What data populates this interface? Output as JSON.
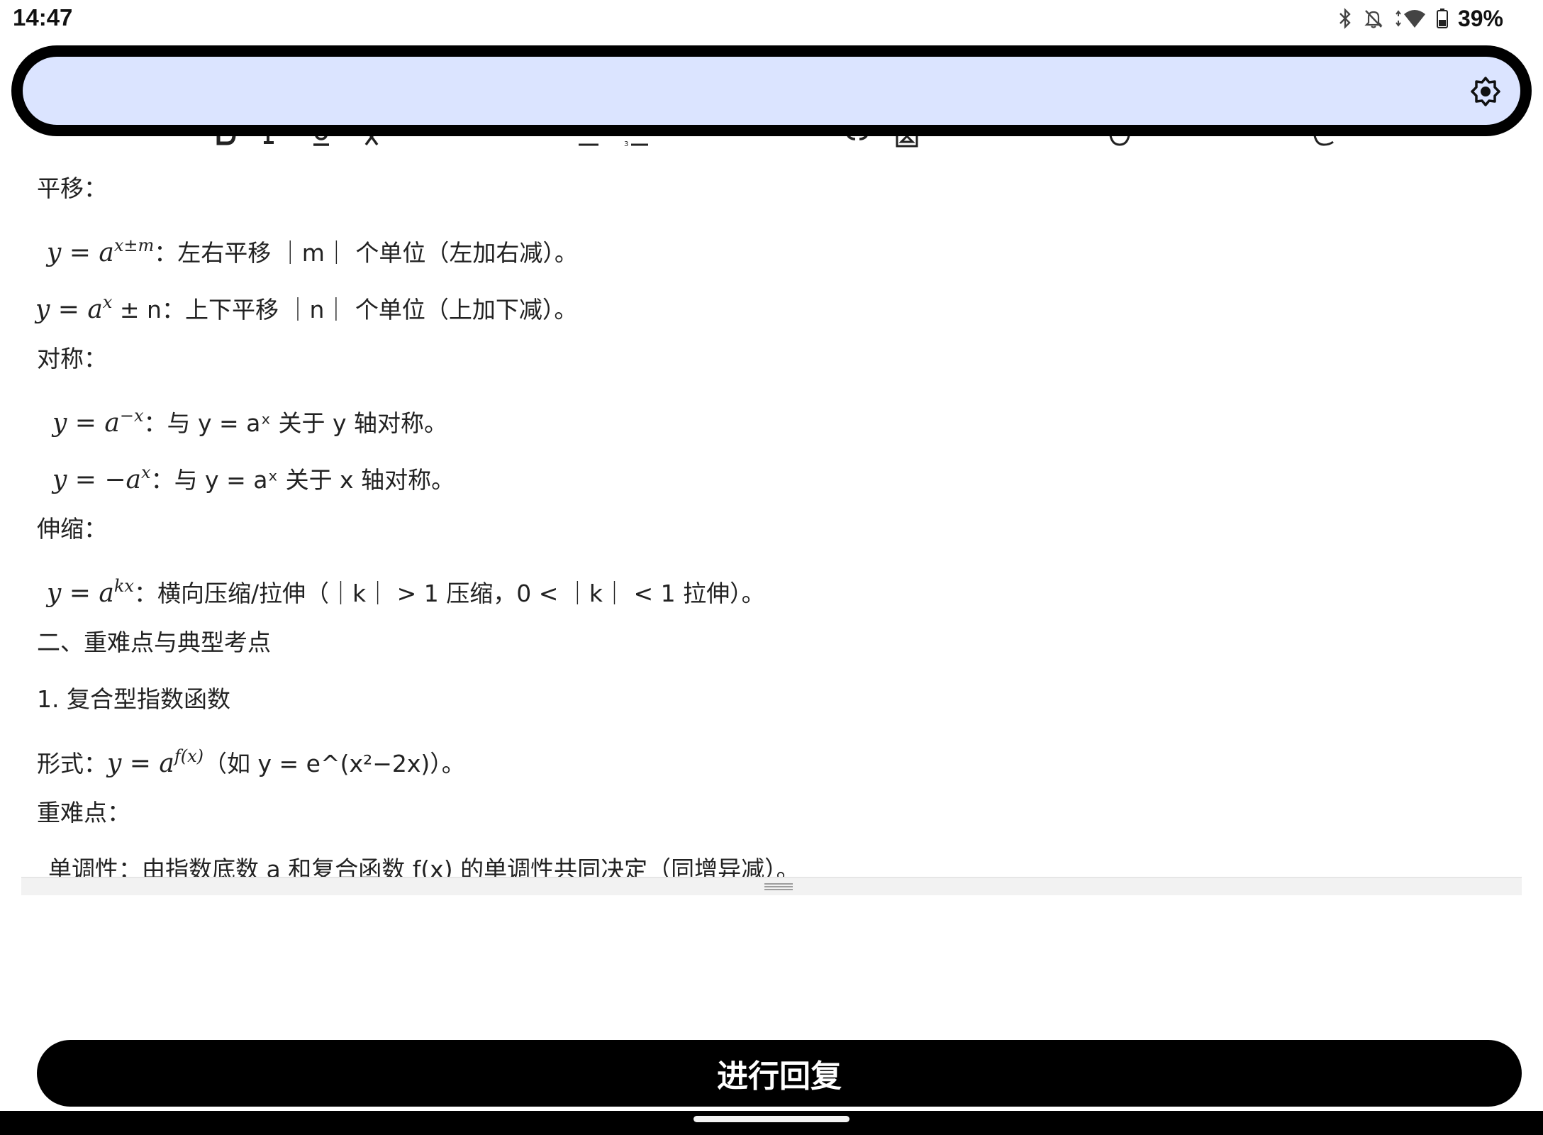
{
  "status_bar": {
    "time": "14:47",
    "battery": "39%",
    "icons": [
      "bluetooth-icon",
      "notifications-off-icon",
      "wifi-icon",
      "battery-icon"
    ]
  },
  "overlay": {
    "color": "#dbe4ff",
    "icon": "brightness-icon"
  },
  "content": {
    "lines": [
      {
        "pre": "平移：",
        "m": "",
        "sup": "",
        "post": ""
      },
      {
        "pre": "",
        "m": "y = a",
        "sup": "x±m",
        "post": "：左右平移 ｜m｜ 个单位（左加右减）。"
      },
      {
        "pre": "",
        "m": "y = a",
        "sup": "x",
        "post": " ± n：上下平移 ｜n｜ 个单位（上加下减）。"
      },
      {
        "pre": "对称：",
        "m": "",
        "sup": "",
        "post": ""
      },
      {
        "pre": "",
        "m": "y = a",
        "sup": "−x",
        "post": "：与 y = aˣ 关于 y 轴对称。"
      },
      {
        "pre": "",
        "m": "y = −a",
        "sup": "x",
        "post": "：与 y = aˣ 关于 x 轴对称。"
      },
      {
        "pre": "伸缩：",
        "m": "",
        "sup": "",
        "post": ""
      },
      {
        "pre": "",
        "m": "y = a",
        "sup": "kx",
        "post": "：横向压缩/拉伸（｜k｜ > 1 压缩，0 < ｜k｜ < 1 拉伸）。"
      },
      {
        "pre": "二、重难点与典型考点",
        "m": "",
        "sup": "",
        "post": ""
      },
      {
        "pre": "1. 复合型指数函数",
        "m": "",
        "sup": "",
        "post": ""
      },
      {
        "pre": "形式：",
        "m": "y = a",
        "sup": "f(x)",
        "post": "（如 y = e^(x²−2x)）。"
      },
      {
        "pre": "重难点：",
        "m": "",
        "sup": "",
        "post": ""
      },
      {
        "pre": "单调性：由指数底数 a 和复合函数 f(x) 的单调性共同决定（同增异减）。",
        "m": "",
        "sup": "",
        "post": ""
      }
    ]
  },
  "reply_button": {
    "label": "进行回复"
  }
}
